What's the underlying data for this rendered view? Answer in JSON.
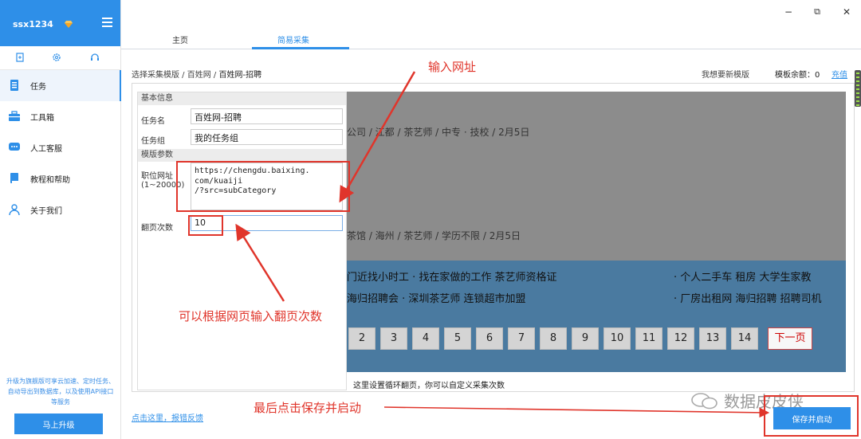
{
  "sidebar": {
    "username": "ssx1234",
    "items": [
      {
        "label": "任务"
      },
      {
        "label": "工具箱"
      },
      {
        "label": "人工客服"
      },
      {
        "label": "教程和帮助"
      },
      {
        "label": "关于我们"
      }
    ],
    "upgrade_text": "升级为旗舰版可享云加速、定时任务、自动导出到数据库，以及使用API接口等服务",
    "upgrade_button": "马上升级",
    "accent_color": "#2e8fe8"
  },
  "tabs": [
    {
      "label": "主页",
      "active": false
    },
    {
      "label": "简易采集",
      "active": true
    }
  ],
  "window_controls": {
    "minimize": "−",
    "restore": "⧉",
    "close": "✕"
  },
  "breadcrumb": {
    "part1": "选择采集模版",
    "sep": " / ",
    "part2": "百姓网",
    "part3": "百姓网-招聘"
  },
  "header_right": {
    "request_template": "我想要新模版",
    "quota_label": "模板余额：0",
    "recharge": "充值"
  },
  "form": {
    "basic_section": "基本信息",
    "task_name_label": "任务名",
    "task_name_value": "百姓网-招聘",
    "task_group_label": "任务组",
    "task_group_value": " 我的任务组",
    "param_section": "模版参数",
    "url_label": "职位网址",
    "url_label_range": "(1~20000)",
    "url_value": "https://chengdu.baixing.\ncom/kuaiji\n/?src=subCategory",
    "pages_label": "翻页次数",
    "pages_value": "10"
  },
  "preview": {
    "line1": "公司 / 江都 / 茶艺师 / 中专 · 技校 / 2月5日",
    "line2": "茶馆 / 海州 / 茶艺师 / 学历不限 / 2月5日",
    "links_row1_left": "门近找小时工     · 找在家做的工作   茶艺师资格证",
    "links_row1_right": "· 个人二手车   租房   大学生家教",
    "links_row2_left": "海归招聘会       · 深圳茶艺师   连锁超市加盟",
    "links_row2_right": "· 厂房出租网   海归招聘   招聘司机",
    "pages": [
      "2",
      "3",
      "4",
      "5",
      "6",
      "7",
      "8",
      "9",
      "10",
      "11",
      "12",
      "13",
      "14"
    ],
    "next": "下一页",
    "bottom_note": "这里设置循环翻页，你可以自定义采集次数"
  },
  "footer": {
    "feedback": "点击这里，报错反馈",
    "save_button": "保存并启动"
  },
  "watermark": "数据皮皮侠",
  "annotations": {
    "url_hint": "输入网址",
    "pages_hint": "可以根据网页输入翻页次数",
    "save_hint": "最后点击保存并启动",
    "color": "#e0352b"
  }
}
